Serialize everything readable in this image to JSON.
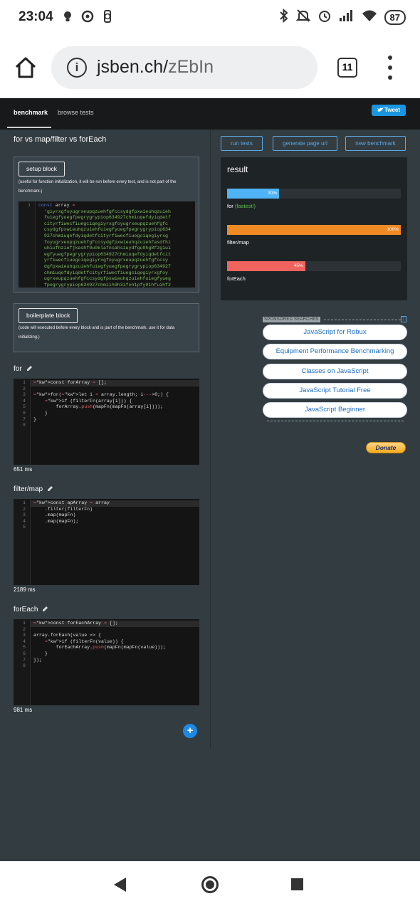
{
  "status_bar": {
    "time": "23:04",
    "battery": "87"
  },
  "browser": {
    "url_host": "jsben.ch/",
    "url_path": "zEbIn",
    "tab_count": "11"
  },
  "nav": {
    "tabs": [
      "benchmark",
      "browse tests"
    ],
    "tweet": "Tweet"
  },
  "benchmark": {
    "title": "for vs map/filter vs forEach"
  },
  "setup": {
    "button": "setup block",
    "note": "(useful for function initialization, it will be run before every test, and is not part of the benchmark.)",
    "line_numbers": [
      "1"
    ],
    "code_lines": [
      "const array = ",
      "  'giyrxgfoyugrxeupqzuehfgfccsydgfpxwieuhqzuieh",
      "  fuiegfyuegfpegrygrypiop634927chmiuqefdyiqdetf",
      "  cityrfiwecfiuegciqegiyrxgfoyugrxeupqzuehfgfc",
      "  csydgfpxwieuhqzuiehfuiegfyuegfpegrygrypiop634",
      "  927chmiuqefdyiqdetfcityrfiwecfiuegciqegiyrxg",
      "  foyugrxeupqzuehfgfccsydgfpxwieuhqzuiehfasdfhi",
      "  uhiufhziefjkashf0u0klafnsahsiuydfgu9hg8fzgiui",
      "  egfyuegfpegrygrypiop634927chmiuqefdyiqdetfcit",
      "  yrfiwecfiuegciqegiyrxgfoyugrxeupqzuehfgfccsy",
      "  dgfpxwieuhqzuiehfuiegfyuegfpegrygrypiop634927",
      "  chmiuqefdyiqdetfcityrfiwecfiuegciqegiyrxgfoy",
      "  ugrxeupqzuehfgfccsydgfpxwieuhqzuiehfuiegfyueg",
      "  fpegrygrypiop634927chmiih9h3ifoh1pfy91hfuihf2"
    ]
  },
  "boilerplate": {
    "button": "boilerplate block",
    "note": "(code will executed before every block and is part of the benchmark. use it for data initializing.)"
  },
  "tests": [
    {
      "name": "for",
      "time": "651 ms",
      "line_numbers": [
        "1",
        "2",
        "3",
        "4",
        "5",
        "6",
        "7",
        "8"
      ],
      "code_lines": [
        "const forArray = [];",
        "",
        "for(let i = array.length; i--->0;) {",
        "    if (filterFn(array[i])) {",
        "        forArray.push(mapFn(mapFn(array[i])));",
        "    }",
        "}",
        ""
      ]
    },
    {
      "name": "filter/map",
      "time": "2189 ms",
      "line_numbers": [
        "1",
        "2",
        "3",
        "4",
        "5"
      ],
      "code_lines": [
        "const apArray = array",
        "    .filter(filterFn)",
        "    .map(mapFn)",
        "    .map(mapFn);",
        ""
      ]
    },
    {
      "name": "forEach",
      "time": "981 ms",
      "line_numbers": [
        "1",
        "2",
        "3",
        "4",
        "5",
        "6",
        "7",
        "8"
      ],
      "code_lines": [
        "const forEachArray = [];",
        "",
        "array.forEach(value => {",
        "    if (filterFn(value)) {",
        "        forEachArray.push(mapFn(mapFn(value)));",
        "    }",
        "});",
        ""
      ]
    }
  ],
  "add_button": "+",
  "actions": {
    "run": "run tests",
    "generate": "generate page url",
    "new": "new benchmark"
  },
  "result": {
    "title": "result",
    "bars": [
      {
        "name": "for",
        "suffix": "(fastest!)",
        "percent": 30,
        "label": "30%",
        "color": "#4fb3f6"
      },
      {
        "name": "filter/map",
        "suffix": "",
        "percent": 100,
        "label": "100%",
        "color": "#f08a24"
      },
      {
        "name": "forEach",
        "suffix": "",
        "percent": 45,
        "label": "45%",
        "color": "#f0635e"
      }
    ]
  },
  "ads": {
    "header": "SPONSORED SEARCHES",
    "items": [
      "JavaScript for Robux",
      "Equipment Performance Benchmarking",
      "Classes on JavaScript",
      "JavaScript Tutorial Free",
      "JavaScript Beginner"
    ]
  },
  "donate": "Donate"
}
